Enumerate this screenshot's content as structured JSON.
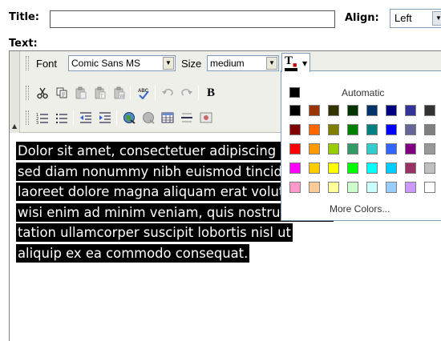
{
  "form": {
    "title_label": "Title:",
    "title_value": "",
    "align_label": "Align:",
    "align_value": "Left",
    "text_label": "Text:"
  },
  "toolbar": {
    "font_label": "Font",
    "font_value": "Comic Sans MS",
    "size_label": "Size",
    "size_value": "medium",
    "bold_label": "B"
  },
  "content_lines": [
    "Dolor sit amet, consectetuer adipiscing elit,",
    "sed diam nonummy nibh euismod tincidunt ut",
    "laoreet dolore magna aliquam erat volutpat. Ut",
    "wisi enim ad minim veniam, quis nostrud exerci",
    "tation ullamcorper suscipit lobortis nisl ut",
    "aliquip ex ea commodo consequat."
  ],
  "color_picker": {
    "automatic_label": "Automatic",
    "automatic_color": "#000000",
    "more_label": "More Colors...",
    "palette": [
      [
        "#000000",
        "#993300",
        "#333300",
        "#003300",
        "#003366",
        "#000080",
        "#333399",
        "#333333"
      ],
      [
        "#800000",
        "#FF6600",
        "#808000",
        "#008000",
        "#008080",
        "#0000FF",
        "#666699",
        "#808080"
      ],
      [
        "#FF0000",
        "#FF9900",
        "#99CC00",
        "#339966",
        "#33CCCC",
        "#3366FF",
        "#800080",
        "#999999"
      ],
      [
        "#FF00FF",
        "#FFCC00",
        "#FFFF00",
        "#00FF00",
        "#00FFFF",
        "#00CCFF",
        "#993366",
        "#C0C0C0"
      ],
      [
        "#FF99CC",
        "#FFCC99",
        "#FFFF99",
        "#CCFFCC",
        "#CCFFFF",
        "#99CCFF",
        "#CC99FF",
        "#FFFFFF"
      ]
    ]
  }
}
